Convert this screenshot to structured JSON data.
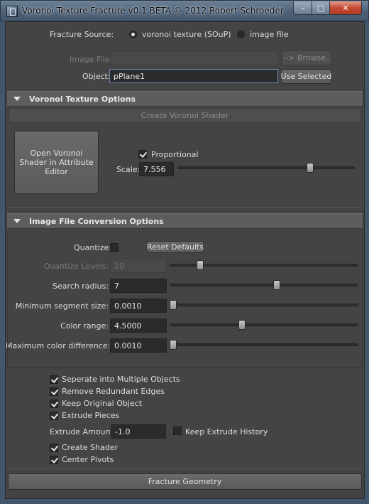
{
  "window": {
    "title": "Voronoi Texture Fracture v0.1 BETA © 2012 Robert Schroeder",
    "app_icon": "maya-window-icon",
    "min_label": "–",
    "max_label": "□",
    "close_label": "✕"
  },
  "source": {
    "label": "Fracture Source:",
    "option_voronoi": "voronoi texture (SOuP)",
    "option_image": "image file",
    "selected": "voronoi texture (SOuP)"
  },
  "image_file": {
    "label": "Image File:",
    "value": "",
    "browse_label": "--> Browse.."
  },
  "object": {
    "label": "Object:",
    "value": "pPlane1",
    "use_selected_label": "Use Selected"
  },
  "voronoi_section": {
    "title": "Voronoi Texture Options",
    "create_shader_label": "Create Voronoi Shader",
    "open_shader_label": "Open Voronoi Shader in Attribute Editor",
    "proportional_label": "Proportional",
    "proportional_checked": true,
    "scale_label": "Scale:",
    "scale_value": "7.556",
    "scale_slider_fraction": 0.76
  },
  "image_section": {
    "title": "Image File Conversion Options",
    "quantize_label": "Quantize:",
    "quantize_checked": false,
    "reset_label": "Reset Defaults",
    "rows": [
      {
        "label": "Quantize Levels:",
        "value": "10",
        "disabled": true,
        "slider_fraction": 0.15
      },
      {
        "label": "Search radius:",
        "value": "7",
        "disabled": false,
        "slider_fraction": 0.57
      },
      {
        "label": "Minimum segment size:",
        "value": "0.0010",
        "disabled": false,
        "slider_fraction": 0.0
      },
      {
        "label": "Color range:",
        "value": "4.5000",
        "disabled": false,
        "slider_fraction": 0.38
      },
      {
        "label": "Maximum color difference:",
        "value": "0.0010",
        "disabled": false,
        "slider_fraction": 0.0
      }
    ]
  },
  "options": {
    "separate_label": "Seperate into Multiple Objects",
    "remove_edges_label": "Remove Redundant Edges",
    "keep_original_label": "Keep Original Object",
    "extrude_pieces_label": "Extrude Pieces",
    "extrude_amount_label": "Extrude Amount:",
    "extrude_amount_value": "-1.0",
    "keep_history_label": "Keep Extrude History",
    "create_shader_label": "Create Shader",
    "center_pivots_label": "Center Pivots",
    "checks": {
      "separate": true,
      "remove_edges": true,
      "keep_original": true,
      "extrude_pieces": true,
      "keep_history": false,
      "create_shader": true,
      "center_pivots": true
    }
  },
  "fracture_button_label": "Fracture Geometry"
}
